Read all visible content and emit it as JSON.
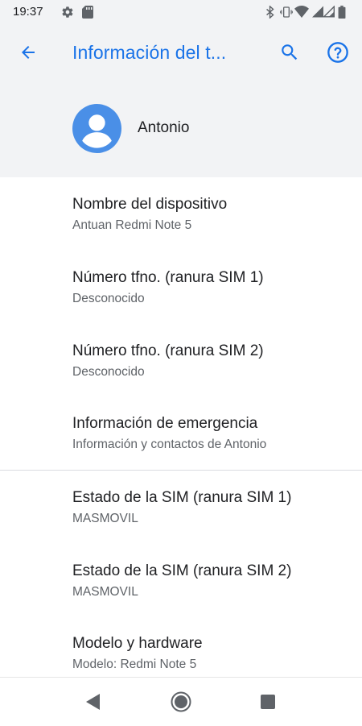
{
  "status_bar": {
    "time": "19:37",
    "icons": [
      "gear-icon",
      "sd-card-icon",
      "bluetooth-icon",
      "vibrate-icon",
      "wifi-icon",
      "signal-icon-1",
      "signal-icon-2",
      "battery-icon"
    ]
  },
  "header": {
    "title": "Información del t...",
    "back_icon": "arrow-left-icon",
    "search_icon": "search-icon",
    "help_icon": "help-circle-icon",
    "accent_color": "#1a73e8"
  },
  "profile": {
    "name": "Antonio",
    "avatar_icon": "account-circle-icon"
  },
  "items": [
    {
      "title": "Nombre del dispositivo",
      "subtitle": "Antuan Redmi Note 5"
    },
    {
      "title": "Número tfno. (ranura SIM 1)",
      "subtitle": "Desconocido"
    },
    {
      "title": "Número tfno. (ranura SIM 2)",
      "subtitle": "Desconocido"
    },
    {
      "title": "Información de emergencia",
      "subtitle": "Información y contactos de Antonio"
    },
    {
      "title": "Estado de la SIM (ranura SIM 1)",
      "subtitle": "MASMOVIL"
    },
    {
      "title": "Estado de la SIM (ranura SIM 2)",
      "subtitle": "MASMOVIL"
    },
    {
      "title": "Modelo y hardware",
      "subtitle": "Modelo: Redmi Note 5"
    }
  ],
  "nav_bar": {
    "back_icon": "nav-back-icon",
    "home_icon": "nav-home-icon",
    "recents_icon": "nav-recents-icon"
  }
}
